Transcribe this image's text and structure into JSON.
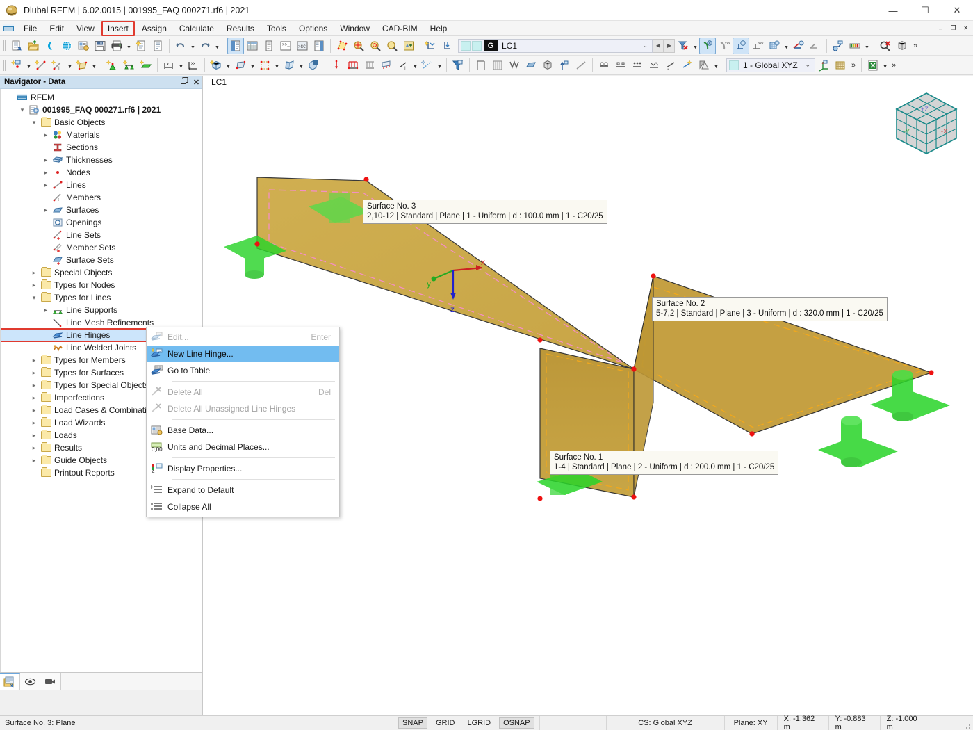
{
  "window": {
    "title": "Dlubal RFEM | 6.02.0015 | 001995_FAQ 000271.rf6 | 2021",
    "app_icon": "dlubal-rfem-icon",
    "minimize": "—",
    "maximize": "☐",
    "close": "✕"
  },
  "menubar": {
    "system_icon": "mdi-system-icon",
    "items": [
      {
        "label": "File",
        "highlighted": false
      },
      {
        "label": "Edit",
        "highlighted": false
      },
      {
        "label": "View",
        "highlighted": false
      },
      {
        "label": "Insert",
        "highlighted": true
      },
      {
        "label": "Assign",
        "highlighted": false
      },
      {
        "label": "Calculate",
        "highlighted": false
      },
      {
        "label": "Results",
        "highlighted": false
      },
      {
        "label": "Tools",
        "highlighted": false
      },
      {
        "label": "Options",
        "highlighted": false
      },
      {
        "label": "Window",
        "highlighted": false
      },
      {
        "label": "CAD-BIM",
        "highlighted": false
      },
      {
        "label": "Help",
        "highlighted": false
      }
    ],
    "mdi_minimize": "–",
    "mdi_restore": "❐",
    "mdi_close": "✕"
  },
  "toolbar_main": {
    "load_case_combo": {
      "badge": "G",
      "value": "LC1",
      "caret": "⌄"
    },
    "coordinate_system_combo": {
      "value": "1 - Global XYZ",
      "caret": "⌄"
    },
    "overflow": "»"
  },
  "navigator": {
    "title": "Navigator - Data",
    "float_icon": "restore-icon",
    "close_icon": "close-icon",
    "tree": [
      {
        "label": "RFEM",
        "indent": 0,
        "icon": "rfem-root-icon",
        "twisty": "",
        "bold": false
      },
      {
        "label": "001995_FAQ 000271.rf6 | 2021",
        "indent": 1,
        "icon": "model-icon",
        "twisty": "down",
        "bold": true
      },
      {
        "label": "Basic Objects",
        "indent": 2,
        "icon": "folder",
        "twisty": "down",
        "bold": false
      },
      {
        "label": "Materials",
        "indent": 3,
        "icon": "materials-icon",
        "twisty": "right",
        "bold": false
      },
      {
        "label": "Sections",
        "indent": 3,
        "icon": "sections-icon",
        "twisty": "",
        "bold": false
      },
      {
        "label": "Thicknesses",
        "indent": 3,
        "icon": "thicknesses-icon",
        "twisty": "right",
        "bold": false
      },
      {
        "label": "Nodes",
        "indent": 3,
        "icon": "nodes-icon",
        "twisty": "right",
        "bold": false
      },
      {
        "label": "Lines",
        "indent": 3,
        "icon": "lines-icon",
        "twisty": "right",
        "bold": false
      },
      {
        "label": "Members",
        "indent": 3,
        "icon": "members-icon",
        "twisty": "",
        "bold": false
      },
      {
        "label": "Surfaces",
        "indent": 3,
        "icon": "surfaces-icon",
        "twisty": "right",
        "bold": false
      },
      {
        "label": "Openings",
        "indent": 3,
        "icon": "openings-icon",
        "twisty": "",
        "bold": false
      },
      {
        "label": "Line Sets",
        "indent": 3,
        "icon": "line-sets-icon",
        "twisty": "",
        "bold": false
      },
      {
        "label": "Member Sets",
        "indent": 3,
        "icon": "member-sets-icon",
        "twisty": "",
        "bold": false
      },
      {
        "label": "Surface Sets",
        "indent": 3,
        "icon": "surface-sets-icon",
        "twisty": "",
        "bold": false
      },
      {
        "label": "Special Objects",
        "indent": 2,
        "icon": "folder",
        "twisty": "right",
        "bold": false
      },
      {
        "label": "Types for Nodes",
        "indent": 2,
        "icon": "folder",
        "twisty": "right",
        "bold": false
      },
      {
        "label": "Types for Lines",
        "indent": 2,
        "icon": "folder",
        "twisty": "down",
        "bold": false
      },
      {
        "label": "Line Supports",
        "indent": 3,
        "icon": "line-supports-icon",
        "twisty": "right",
        "bold": false
      },
      {
        "label": "Line Mesh Refinements",
        "indent": 3,
        "icon": "line-mesh-refinements-icon",
        "twisty": "",
        "bold": false
      },
      {
        "label": "Line Hinges",
        "indent": 3,
        "icon": "line-hinges-icon",
        "twisty": "",
        "bold": false,
        "selected": true
      },
      {
        "label": "Line Welded Joints",
        "indent": 3,
        "icon": "line-welded-joints-icon",
        "twisty": "",
        "bold": false
      },
      {
        "label": "Types for Members",
        "indent": 2,
        "icon": "folder",
        "twisty": "right",
        "bold": false
      },
      {
        "label": "Types for Surfaces",
        "indent": 2,
        "icon": "folder",
        "twisty": "right",
        "bold": false
      },
      {
        "label": "Types for Special Objects",
        "indent": 2,
        "icon": "folder",
        "twisty": "right",
        "bold": false
      },
      {
        "label": "Imperfections",
        "indent": 2,
        "icon": "folder",
        "twisty": "right",
        "bold": false
      },
      {
        "label": "Load Cases & Combinations",
        "indent": 2,
        "icon": "folder",
        "twisty": "right",
        "bold": false
      },
      {
        "label": "Load Wizards",
        "indent": 2,
        "icon": "folder",
        "twisty": "right",
        "bold": false
      },
      {
        "label": "Loads",
        "indent": 2,
        "icon": "folder",
        "twisty": "right",
        "bold": false
      },
      {
        "label": "Results",
        "indent": 2,
        "icon": "folder",
        "twisty": "right",
        "bold": false
      },
      {
        "label": "Guide Objects",
        "indent": 2,
        "icon": "folder",
        "twisty": "right",
        "bold": false
      },
      {
        "label": "Printout Reports",
        "indent": 2,
        "icon": "folder",
        "twisty": "",
        "bold": false
      }
    ],
    "footer_tabs": [
      {
        "icon": "data-navigator-icon",
        "active": true
      },
      {
        "icon": "display-eye-icon",
        "active": false
      },
      {
        "icon": "video-camera-icon",
        "active": false
      }
    ]
  },
  "context_menu": {
    "items": [
      {
        "label": "Edit...",
        "accel": "Enter",
        "icon": "edit-line-hinge-icon",
        "disabled": true,
        "highlighted": false,
        "separator_after": false
      },
      {
        "label": "New Line Hinge...",
        "accel": "",
        "icon": "new-line-hinge-icon",
        "disabled": false,
        "highlighted": true,
        "separator_after": false
      },
      {
        "label": "Go to Table",
        "accel": "",
        "icon": "go-to-table-icon",
        "disabled": false,
        "highlighted": false,
        "separator_after": true
      },
      {
        "label": "Delete All",
        "accel": "Del",
        "icon": "delete-all-icon",
        "disabled": true,
        "highlighted": false,
        "separator_after": false
      },
      {
        "label": "Delete All Unassigned Line Hinges",
        "accel": "",
        "icon": "delete-unassigned-icon",
        "disabled": true,
        "highlighted": false,
        "separator_after": true
      },
      {
        "label": "Base Data...",
        "accel": "",
        "icon": "base-data-icon",
        "disabled": false,
        "highlighted": false,
        "separator_after": false
      },
      {
        "label": "Units and Decimal Places...",
        "accel": "",
        "icon": "units-decimal-icon",
        "disabled": false,
        "highlighted": false,
        "separator_after": true
      },
      {
        "label": "Display Properties...",
        "accel": "",
        "icon": "display-properties-icon",
        "disabled": false,
        "highlighted": false,
        "separator_after": true
      },
      {
        "label": "Expand to Default",
        "accel": "",
        "icon": "expand-to-default-icon",
        "disabled": false,
        "highlighted": false,
        "separator_after": false
      },
      {
        "label": "Collapse All",
        "accel": "",
        "icon": "collapse-all-icon",
        "disabled": false,
        "highlighted": false,
        "separator_after": false
      }
    ]
  },
  "viewport": {
    "tab_label": "LC1",
    "axes": {
      "x": "x",
      "y": "y",
      "z": "z"
    },
    "view_cube": {
      "top": "+Z",
      "left": "-Y",
      "right": "-X"
    },
    "tooltips": [
      {
        "name": "surface-3-tooltip",
        "line1": "Surface No. 3",
        "line2": "2,10-12 | Standard | Plane | 1 - Uniform | d : 100.0 mm | 1 - C20/25"
      },
      {
        "name": "surface-2-tooltip",
        "line1": "Surface No. 2",
        "line2": "5-7,2 | Standard | Plane | 3 - Uniform | d : 320.0 mm | 1 - C20/25"
      },
      {
        "name": "surface-1-tooltip",
        "line1": "Surface No. 1",
        "line2": "1-4 | Standard | Plane | 2 - Uniform | d : 200.0 mm | 1 - C20/25"
      }
    ],
    "colors": {
      "surface_fill": "#c9a43c",
      "surface_fill_light": "#d3b052",
      "support_green": "#2fd32f",
      "node_red": "#ee1111",
      "hinge_pink": "#f08fc0",
      "hinge_orange": "#f0a020"
    }
  },
  "statusbar": {
    "message": "Surface No. 3: Plane",
    "toggles": [
      {
        "label": "SNAP",
        "on": true
      },
      {
        "label": "GRID",
        "on": false
      },
      {
        "label": "LGRID",
        "on": false
      },
      {
        "label": "OSNAP",
        "on": true
      }
    ],
    "cs": "CS: Global XYZ",
    "plane": "Plane: XY",
    "x": "X: -1.362 m",
    "y": "Y: -0.883 m",
    "z": "Z: -1.000 m"
  }
}
